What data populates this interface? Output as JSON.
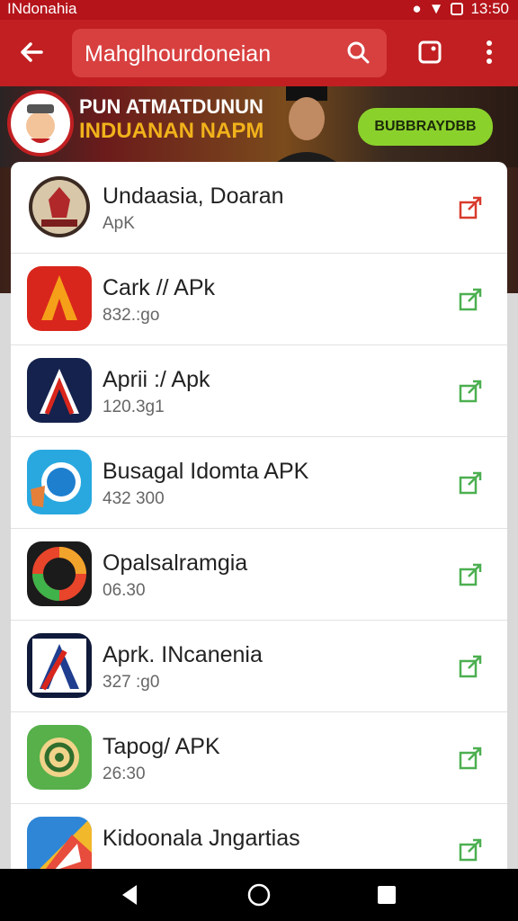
{
  "status_bar": {
    "carrier": "INdonahia",
    "time": "13:50"
  },
  "app_bar": {
    "search_query": "Mahglhourdoneian"
  },
  "banner": {
    "line1": "PUN ATMATDUNUN",
    "line2": "INDUANAN NAPM",
    "cta": "BUBBRAYDBB"
  },
  "apps": [
    {
      "name": "Undaasia, Doaran",
      "meta": "ApK",
      "icon": "emblem-icon",
      "open_color": "#d83a2e"
    },
    {
      "name": "Cark // APk",
      "meta": "832.:go",
      "icon": "red-orange-a-icon",
      "open_color": "#4caf50"
    },
    {
      "name": "Aprii :/ Apk",
      "meta": "120.3g1",
      "icon": "navy-a-icon",
      "open_color": "#4caf50"
    },
    {
      "name": "Busagal Idomta APK",
      "meta": "432 300",
      "icon": "blue-badge-icon",
      "open_color": "#4caf50"
    },
    {
      "name": "Opalsalramgia",
      "meta": "06.30",
      "icon": "colorful-ring-icon",
      "open_color": "#4caf50"
    },
    {
      "name": "Aprk. INcanenia",
      "meta": "327 :g0",
      "icon": "navy-a-icon",
      "open_color": "#4caf50"
    },
    {
      "name": "Tapog/ APK",
      "meta": "26:30",
      "icon": "green-target-icon",
      "open_color": "#4caf50"
    },
    {
      "name": "Kidoonala Jngartias",
      "meta": "",
      "icon": "multicolor-leaf-icon",
      "open_color": "#4caf50"
    }
  ]
}
